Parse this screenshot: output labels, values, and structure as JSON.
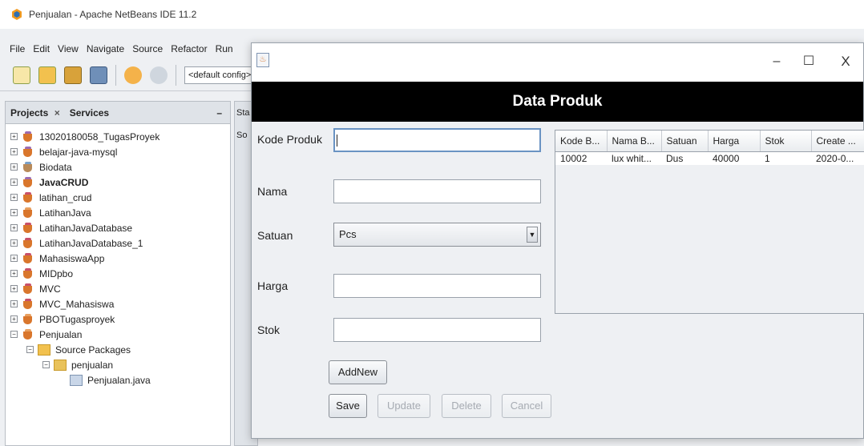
{
  "ide": {
    "window_title": "Penjualan - Apache NetBeans IDE 11.2",
    "menu": [
      "File",
      "Edit",
      "View",
      "Navigate",
      "Source",
      "Refactor",
      "Run"
    ],
    "config_combo": "<default config>",
    "projects_tabs": {
      "projects": "Projects",
      "services": "Services",
      "close_glyph": "×",
      "minimize_glyph": "–"
    },
    "editor_strip_labels": [
      "Sta",
      "So"
    ],
    "projects": [
      {
        "label": "13020180058_TugasProyek",
        "toggle": "+"
      },
      {
        "label": "belajar-java-mysql",
        "toggle": "+"
      },
      {
        "label": "Biodata",
        "toggle": "+"
      },
      {
        "label": "JavaCRUD",
        "toggle": "+"
      },
      {
        "label": "latihan_crud",
        "toggle": "+"
      },
      {
        "label": "LatihanJava",
        "toggle": "+"
      },
      {
        "label": "LatihanJavaDatabase",
        "toggle": "+"
      },
      {
        "label": "LatihanJavaDatabase_1",
        "toggle": "+"
      },
      {
        "label": "MahasiswaApp",
        "toggle": "+"
      },
      {
        "label": "MIDpbo",
        "toggle": "+"
      },
      {
        "label": "MVC",
        "toggle": "+"
      },
      {
        "label": "MVC_Mahasiswa",
        "toggle": "+"
      },
      {
        "label": "PBOTugasproyek",
        "toggle": "+"
      },
      {
        "label": "Penjualan",
        "toggle": "−"
      }
    ],
    "source_packages": {
      "label": "Source Packages",
      "toggle": "−"
    },
    "package": {
      "label": "penjualan",
      "toggle": "−"
    },
    "java_file": {
      "label": "Penjualan.java"
    }
  },
  "dialog": {
    "window_controls": {
      "minimize": "–",
      "maximize": "☐",
      "close": "X"
    },
    "header_title": "Data Produk",
    "form": {
      "kode_produk": {
        "label": "Kode Produk",
        "value": ""
      },
      "nama": {
        "label": "Nama",
        "value": ""
      },
      "satuan": {
        "label": "Satuan",
        "selected": "Pcs",
        "arrow": "▼"
      },
      "harga": {
        "label": "Harga",
        "value": ""
      },
      "stok": {
        "label": "Stok",
        "value": ""
      }
    },
    "buttons": {
      "addnew": "AddNew",
      "save": "Save",
      "update": "Update",
      "delete": "Delete",
      "cancel": "Cancel"
    },
    "table": {
      "columns": [
        "Kode B...",
        "Nama B...",
        "Satuan",
        "Harga",
        "Stok",
        "Create ..."
      ],
      "rows": [
        [
          "10002",
          "lux whit...",
          "Dus",
          "40000",
          "1",
          "2020-0..."
        ]
      ]
    }
  }
}
